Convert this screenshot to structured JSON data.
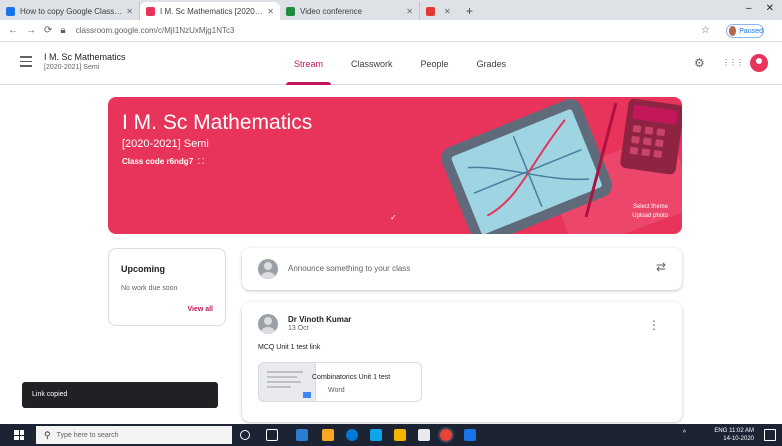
{
  "browser": {
    "tabs": [
      {
        "title": "How to copy Google Classroom code",
        "color": "#1a73e8",
        "active": false
      },
      {
        "title": "I M. Sc Mathematics [2020-2021]",
        "color": "#e8345b",
        "active": true
      },
      {
        "title": "Video conference",
        "color": "#1e8e3e",
        "active": false
      },
      {
        "title": "",
        "color": "#e53935",
        "active": false
      }
    ],
    "new_tab": "+",
    "window_controls": [
      "–",
      "✕"
    ],
    "back": "←",
    "forward": "→",
    "reload": "⟳",
    "url": "classroom.google.com/c/MjI1NzUxMjg1NTc3",
    "profile_label": "Paused"
  },
  "header": {
    "class_name": "I M. Sc Mathematics",
    "class_subtitle": "[2020-2021] Semi",
    "tabs": [
      {
        "label": "Stream",
        "active": true
      },
      {
        "label": "Classwork",
        "active": false
      },
      {
        "label": "People",
        "active": false
      },
      {
        "label": "Grades",
        "active": false
      }
    ],
    "settings_icon": "⚙",
    "apps_icon": "⋮⋮⋮"
  },
  "banner": {
    "title": "I M. Sc Mathematics",
    "subtitle": "[2020-2021] Semi",
    "class_code_label": "Class code  r6ndg7",
    "class_code_icon": "⛶",
    "select_theme": "Select theme",
    "upload_photo": "Upload photo",
    "chevron": "✓",
    "color": "#e8345b"
  },
  "upcoming": {
    "title": "Upcoming",
    "text": "No work due soon",
    "view_all": "View all"
  },
  "announce": {
    "placeholder": "Announce something to your class",
    "icon": "⇄"
  },
  "post": {
    "author": "Dr Vinoth Kumar",
    "date": "13 Oct",
    "body": "MCQ Unit 1 test link",
    "attachment_title": "Combinatorics Unit 1 test",
    "attachment_type": "Word",
    "more_icon": "⋮"
  },
  "toast": {
    "text": "Link copied"
  },
  "taskbar": {
    "search_placeholder": "Type here to search",
    "search_icon": "⚲",
    "time": "11:02 AM",
    "date": "14-10-2020",
    "lang": "ENG",
    "tray_arrow": "^",
    "icon_colors": [
      "#ffffff",
      "#2d7dd2",
      "#f9a825",
      "#0078d7",
      "#0ea5e9",
      "#f4b400",
      "#e8eaed",
      "#ea4335",
      "#1a73e8"
    ]
  }
}
